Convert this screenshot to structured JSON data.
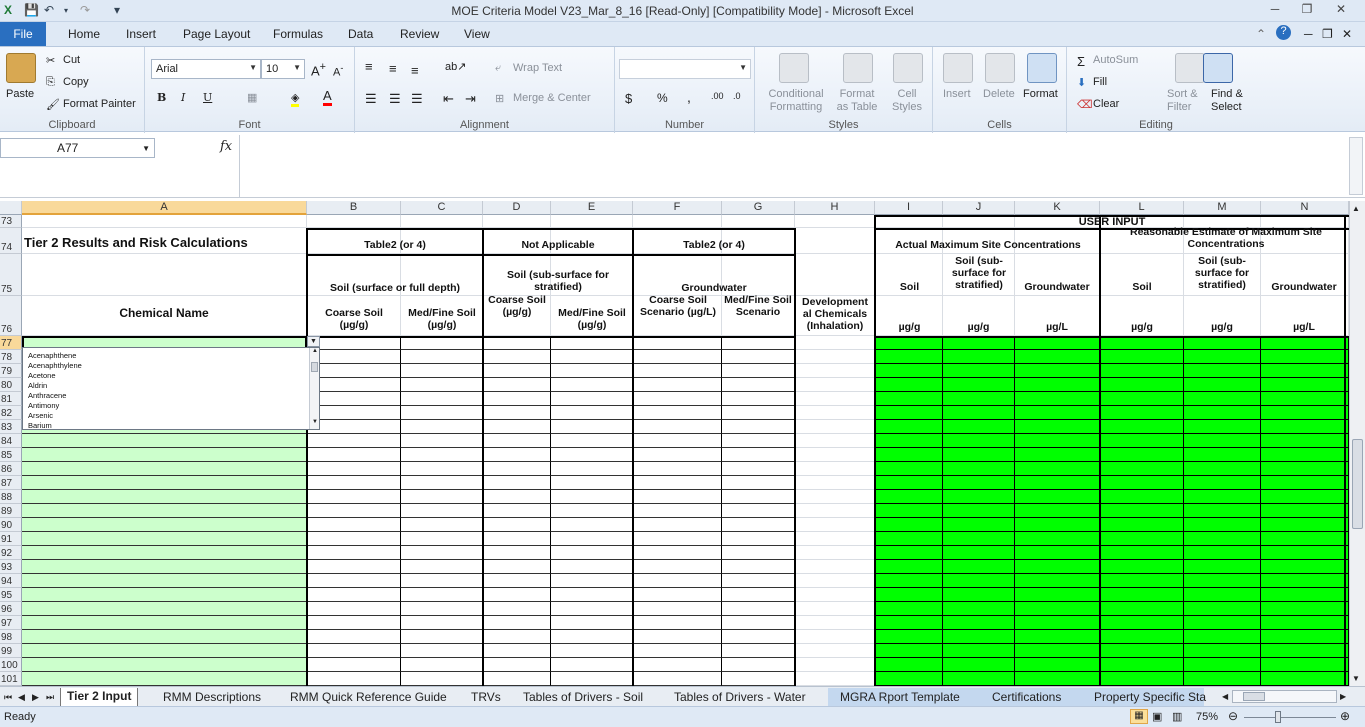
{
  "window": {
    "title": "MOE Criteria Model V23_Mar_8_16  [Read-Only]  [Compatibility Mode]  -  Microsoft Excel",
    "app_icon": "excel-icon"
  },
  "menu": {
    "file": "File",
    "tabs": [
      "Home",
      "Insert",
      "Page Layout",
      "Formulas",
      "Data",
      "Review",
      "View"
    ]
  },
  "ribbon": {
    "clipboard": {
      "paste": "Paste",
      "cut": "Cut",
      "copy": "Copy",
      "format_painter": "Format Painter",
      "label": "Clipboard"
    },
    "font": {
      "name": "Arial",
      "size": "10",
      "bold": "B",
      "italic": "I",
      "underline": "U",
      "label": "Font"
    },
    "alignment": {
      "wrap": "Wrap Text",
      "merge": "Merge & Center",
      "label": "Alignment"
    },
    "number": {
      "currency": "$",
      "percent": "%",
      "comma": ",",
      "label": "Number"
    },
    "styles": {
      "conditional": "Conditional\nFormatting",
      "format_table": "Format\nas Table",
      "cell_styles": "Cell\nStyles",
      "label": "Styles"
    },
    "cells": {
      "insert": "Insert",
      "delete": "Delete",
      "format": "Format",
      "label": "Cells"
    },
    "editing": {
      "autosum": "AutoSum",
      "fill": "Fill",
      "clear": "Clear",
      "sort": "Sort &\nFilter",
      "find": "Find &\nSelect",
      "label": "Editing"
    }
  },
  "formula_bar": {
    "name_box": "A77",
    "fx": "fx",
    "value": ""
  },
  "columns": [
    "A",
    "B",
    "C",
    "D",
    "E",
    "F",
    "G",
    "H",
    "I",
    "J",
    "K",
    "L",
    "M",
    "N"
  ],
  "rows": [
    "73",
    "74",
    "75",
    "76",
    "77",
    "78",
    "79",
    "80",
    "81",
    "82",
    "83",
    "84",
    "85",
    "86",
    "87",
    "88",
    "89",
    "90",
    "91",
    "92",
    "93",
    "94",
    "95",
    "96",
    "97",
    "98",
    "99",
    "100",
    "101"
  ],
  "sheet": {
    "tier_title": "Tier 2   Results and Risk Calculations",
    "chemical_name": "Chemical Name",
    "user_input": "USER INPUT",
    "groups": {
      "table2_a": "Table2 (or 4)",
      "not_applicable": "Not Applicable",
      "table2_b": "Table2 (or 4)",
      "actual_max": "Actual Maximum Site Concentrations",
      "reasonable_est": "Reasonable Estimate of Maximum Site Concentrations"
    },
    "sub": {
      "soil_surface": "Soil (surface or full depth)",
      "soil_sub": "Soil (sub-surface for stratified)",
      "groundwater": "Groundwater",
      "soil": "Soil",
      "soil_sub_short": "Soil (sub-surface for stratified)",
      "gw": "Groundwater"
    },
    "cols76": {
      "b": "Coarse Soil (µg/g)",
      "c": "Med/Fine Soil (µg/g)",
      "d": "Coarse Soil (µg/g)",
      "e": "Med/Fine Soil (µg/g)",
      "f": "Coarse Soil Scenario (µg/L)",
      "g": "Med/Fine Soil Scenario",
      "h": "Development al Chemicals (Inhalation)",
      "i": "µg/g",
      "j": "µg/g",
      "k": "µg/L",
      "l": "µg/g",
      "m": "µg/g",
      "n": "µg/L"
    }
  },
  "dropdown": {
    "items": [
      "Acenaphthene",
      "Acenaphthylene",
      "Acetone",
      "Aldrin",
      "Anthracene",
      "Antimony",
      "Arsenic",
      "Barium"
    ]
  },
  "sheet_tabs": [
    "Tier 2 Input",
    "RMM Descriptions",
    "RMM Quick Reference Guide",
    "TRVs",
    "Tables of Drivers - Soil",
    "Tables of Drivers - Water",
    "MGRA Rport Template",
    "Certifications",
    "Property Specific Sta"
  ],
  "status": {
    "ready": "Ready",
    "zoom": "75%"
  },
  "colors": {
    "green_input": "#00ff00",
    "light_green": "#ccffcc",
    "excel_blue": "#2a6fc0"
  }
}
